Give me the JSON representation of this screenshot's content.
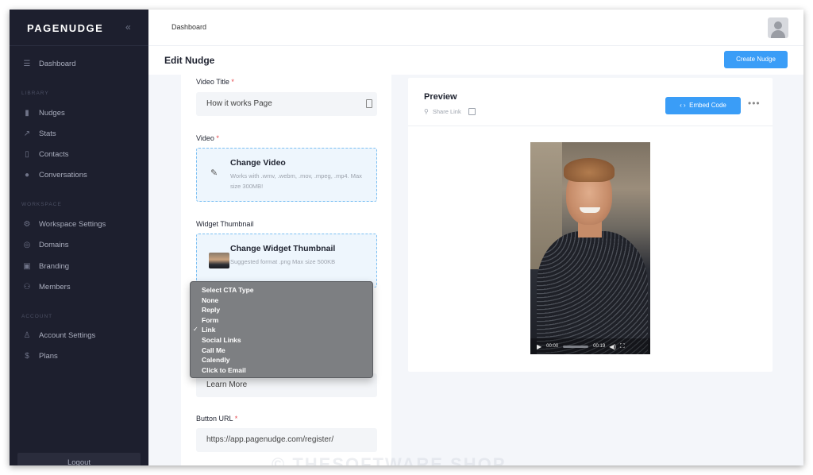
{
  "brand": {
    "logo_text": "PAGENUDGE",
    "accent": "#3a9df7",
    "sidebar_bg": "#1d1f2e"
  },
  "sidebar": {
    "collapse_icon": "double-chevron-left-icon",
    "top_item": {
      "label": "Dashboard",
      "icon": "menu-icon"
    },
    "sections": [
      {
        "label": "LIBRARY",
        "items": [
          {
            "label": "Nudges",
            "icon": "nudges-icon"
          },
          {
            "label": "Stats",
            "icon": "stats-icon"
          },
          {
            "label": "Contacts",
            "icon": "contacts-icon"
          },
          {
            "label": "Conversations",
            "icon": "messenger-icon"
          }
        ]
      },
      {
        "label": "WORKSPACE",
        "items": [
          {
            "label": "Workspace Settings",
            "icon": "gear-icon"
          },
          {
            "label": "Domains",
            "icon": "globe-icon"
          },
          {
            "label": "Branding",
            "icon": "branding-icon"
          },
          {
            "label": "Members",
            "icon": "members-icon"
          }
        ]
      },
      {
        "label": "ACCOUNT",
        "items": [
          {
            "label": "Account Settings",
            "icon": "user-icon"
          },
          {
            "label": "Plans",
            "icon": "dollar-icon"
          }
        ]
      }
    ],
    "logout_label": "Logout"
  },
  "topbar": {
    "breadcrumb": "Dashboard"
  },
  "header": {
    "title": "Edit Nudge",
    "create_button": "Create Nudge"
  },
  "form": {
    "video_title": {
      "label": "Video Title",
      "value": "How it works Page"
    },
    "video": {
      "label": "Video",
      "upload_title": "Change Video",
      "upload_hint": "Works with .wmv, .webm, .mov, .mpeg, .mp4. Max size 300MB!"
    },
    "thumbnail": {
      "label": "Widget Thumbnail",
      "upload_title": "Change Widget Thumbnail",
      "upload_hint": "Suggested format .png Max size 500KB"
    },
    "cta_button_text": {
      "value": "Learn More"
    },
    "button_url": {
      "label": "Button URL",
      "value": "https://app.pagenudge.com/register/"
    },
    "required_mark": "*"
  },
  "cta_dropdown": {
    "options": [
      "Select CTA Type",
      "None",
      "Reply",
      "Form",
      "Link",
      "Social Links",
      "Call Me",
      "Calendly",
      "Click to Email"
    ],
    "selected": "Link"
  },
  "preview": {
    "title": "Preview",
    "share_link": "Share Link",
    "embed_button": "Embed Code",
    "embed_icon": "code-icon",
    "video_controls": {
      "current_time": "00:00",
      "duration": "00:19"
    }
  },
  "watermark": "© THESOFTWARE.SHOP"
}
